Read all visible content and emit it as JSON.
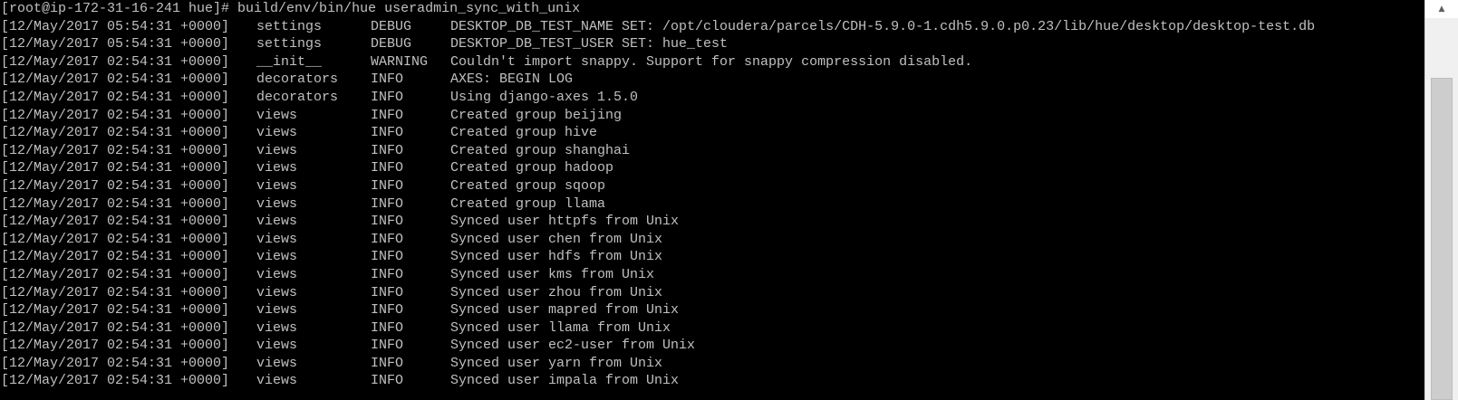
{
  "terminal": {
    "prompt": "[root@ip-172-31-16-241 hue]# build/env/bin/hue useradmin_sync_with_unix",
    "log": [
      {
        "ts": "[12/May/2017 05:54:31 +0000]",
        "module": "settings",
        "level": "DEBUG",
        "message": "DESKTOP_DB_TEST_NAME SET: /opt/cloudera/parcels/CDH-5.9.0-1.cdh5.9.0.p0.23/lib/hue/desktop/desktop-test.db"
      },
      {
        "ts": "[12/May/2017 05:54:31 +0000]",
        "module": "settings",
        "level": "DEBUG",
        "message": "DESKTOP_DB_TEST_USER SET: hue_test"
      },
      {
        "ts": "[12/May/2017 02:54:31 +0000]",
        "module": "__init__",
        "level": "WARNING",
        "message": "Couldn't import snappy. Support for snappy compression disabled."
      },
      {
        "ts": "[12/May/2017 02:54:31 +0000]",
        "module": "decorators",
        "level": "INFO",
        "message": "AXES: BEGIN LOG"
      },
      {
        "ts": "[12/May/2017 02:54:31 +0000]",
        "module": "decorators",
        "level": "INFO",
        "message": "Using django-axes 1.5.0"
      },
      {
        "ts": "[12/May/2017 02:54:31 +0000]",
        "module": "views",
        "level": "INFO",
        "message": "Created group beijing"
      },
      {
        "ts": "[12/May/2017 02:54:31 +0000]",
        "module": "views",
        "level": "INFO",
        "message": "Created group hive"
      },
      {
        "ts": "[12/May/2017 02:54:31 +0000]",
        "module": "views",
        "level": "INFO",
        "message": "Created group shanghai"
      },
      {
        "ts": "[12/May/2017 02:54:31 +0000]",
        "module": "views",
        "level": "INFO",
        "message": "Created group hadoop"
      },
      {
        "ts": "[12/May/2017 02:54:31 +0000]",
        "module": "views",
        "level": "INFO",
        "message": "Created group sqoop"
      },
      {
        "ts": "[12/May/2017 02:54:31 +0000]",
        "module": "views",
        "level": "INFO",
        "message": "Created group llama"
      },
      {
        "ts": "[12/May/2017 02:54:31 +0000]",
        "module": "views",
        "level": "INFO",
        "message": "Synced user httpfs from Unix"
      },
      {
        "ts": "[12/May/2017 02:54:31 +0000]",
        "module": "views",
        "level": "INFO",
        "message": "Synced user chen from Unix"
      },
      {
        "ts": "[12/May/2017 02:54:31 +0000]",
        "module": "views",
        "level": "INFO",
        "message": "Synced user hdfs from Unix"
      },
      {
        "ts": "[12/May/2017 02:54:31 +0000]",
        "module": "views",
        "level": "INFO",
        "message": "Synced user kms from Unix"
      },
      {
        "ts": "[12/May/2017 02:54:31 +0000]",
        "module": "views",
        "level": "INFO",
        "message": "Synced user zhou from Unix"
      },
      {
        "ts": "[12/May/2017 02:54:31 +0000]",
        "module": "views",
        "level": "INFO",
        "message": "Synced user mapred from Unix"
      },
      {
        "ts": "[12/May/2017 02:54:31 +0000]",
        "module": "views",
        "level": "INFO",
        "message": "Synced user llama from Unix"
      },
      {
        "ts": "[12/May/2017 02:54:31 +0000]",
        "module": "views",
        "level": "INFO",
        "message": "Synced user ec2-user from Unix"
      },
      {
        "ts": "[12/May/2017 02:54:31 +0000]",
        "module": "views",
        "level": "INFO",
        "message": "Synced user yarn from Unix"
      },
      {
        "ts": "[12/May/2017 02:54:31 +0000]",
        "module": "views",
        "level": "INFO",
        "message": "Synced user impala from Unix"
      }
    ]
  },
  "scrollbar": {
    "up_arrow_icon": "arrow-up-icon"
  }
}
